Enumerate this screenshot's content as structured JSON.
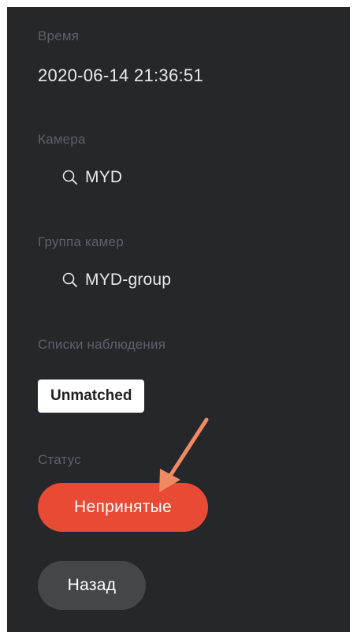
{
  "fields": {
    "time": {
      "label": "Время",
      "value": "2020-06-14 21:36:51"
    },
    "camera": {
      "label": "Камера",
      "value": "MYD",
      "icon": "search-icon"
    },
    "camera_group": {
      "label": "Группа камер",
      "value": "MYD-group",
      "icon": "search-icon"
    },
    "watchlists": {
      "label": "Списки наблюдения",
      "badge": "Unmatched"
    },
    "status": {
      "label": "Статус",
      "button": "Непринятые",
      "color": "#e84a33"
    }
  },
  "actions": {
    "back_label": "Назад"
  },
  "annotation": {
    "icon": "arrow-annotation-icon",
    "color": "#f08a64"
  }
}
